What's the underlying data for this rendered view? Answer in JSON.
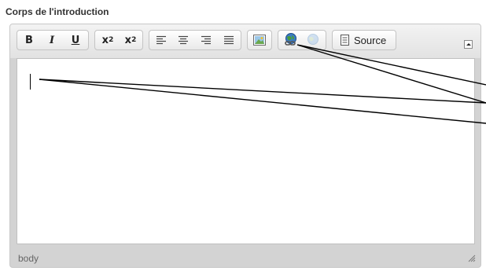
{
  "field": {
    "label": "Corps de l'introduction"
  },
  "toolbar": {
    "bold_label": "B",
    "italic_label": "I",
    "underline_label": "U",
    "subscript_label": "x",
    "subscript_suffix": "2",
    "superscript_label": "x",
    "superscript_suffix": "2",
    "source_label": "Source",
    "icons": {
      "align_left": "align-left-icon",
      "align_center": "align-center-icon",
      "align_right": "align-right-icon",
      "align_justify": "align-justify-icon",
      "image": "image-icon",
      "link": "link-globe-icon",
      "unlink": "unlink-globe-icon",
      "source": "source-document-icon",
      "collapse": "collapse-toolbar-icon"
    }
  },
  "statusbar": {
    "path": "body"
  },
  "colors": {
    "toolbar_bg": "#e9e9e9",
    "frame_bg": "#d3d3d3",
    "content_bg": "#ffffff",
    "callout_line": "#000000"
  }
}
